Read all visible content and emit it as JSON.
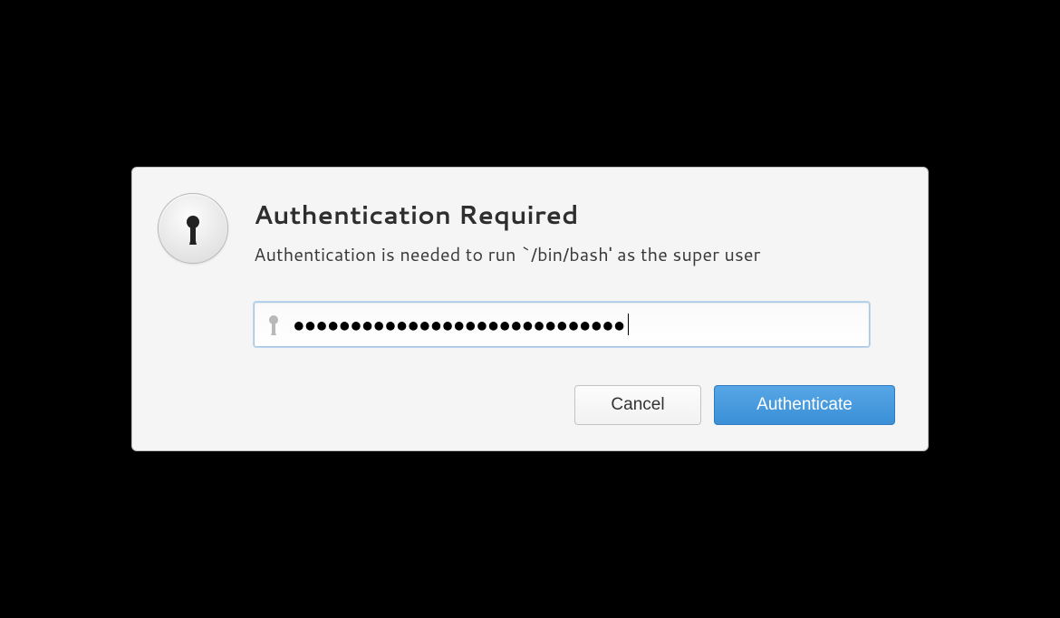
{
  "dialog": {
    "title": "Authentication Required",
    "message": "Authentication is needed to run `/bin/bash' as the super user",
    "password_masked": "●●●●●●●●●●●●●●●●●●●●●●●●●●●●●",
    "buttons": {
      "cancel": "Cancel",
      "authenticate": "Authenticate"
    }
  }
}
